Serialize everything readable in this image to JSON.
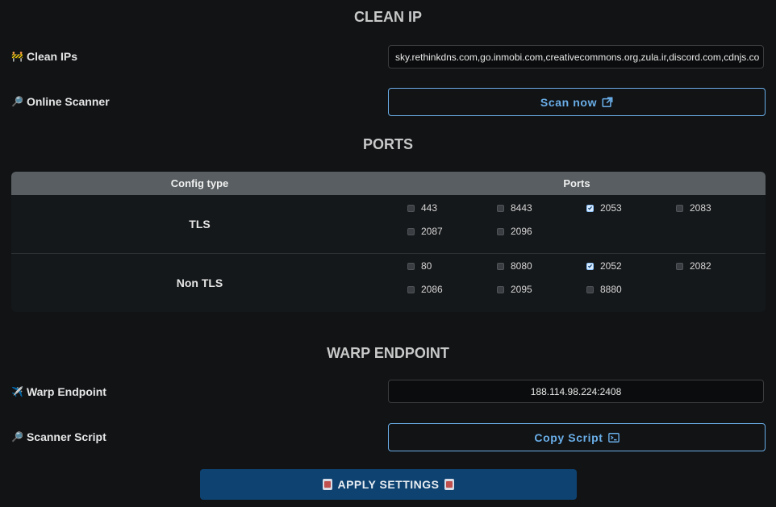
{
  "sections": {
    "clean_ip": "CLEAN IP",
    "ports": "PORTS",
    "warp_endpoint": "WARP ENDPOINT"
  },
  "clean_ip": {
    "label_icon": "🚧",
    "label": "Clean IPs",
    "value": "sky.rethinkdns.com,go.inmobi.com,creativecommons.org,zula.ir,discord.com,cdnjs.co",
    "scanner_icon": "🔎",
    "scanner_label": "Online Scanner",
    "scan_button": "Scan now"
  },
  "ports_table": {
    "header_config": "Config type",
    "header_ports": "Ports",
    "rows": [
      {
        "type": "TLS",
        "ports": [
          {
            "port": "443",
            "checked": false
          },
          {
            "port": "8443",
            "checked": false
          },
          {
            "port": "2053",
            "checked": true
          },
          {
            "port": "2083",
            "checked": false
          },
          {
            "port": "2087",
            "checked": false
          },
          {
            "port": "2096",
            "checked": false
          }
        ]
      },
      {
        "type": "Non TLS",
        "ports": [
          {
            "port": "80",
            "checked": false
          },
          {
            "port": "8080",
            "checked": false
          },
          {
            "port": "2052",
            "checked": true
          },
          {
            "port": "2082",
            "checked": false
          },
          {
            "port": "2086",
            "checked": false
          },
          {
            "port": "2095",
            "checked": false
          },
          {
            "port": "8880",
            "checked": false
          }
        ]
      }
    ]
  },
  "warp": {
    "label_icon": "✈️",
    "label": "Warp Endpoint",
    "value": "188.114.98.224:2408",
    "script_icon": "🔎",
    "script_label": "Scanner Script",
    "copy_button": "Copy Script"
  },
  "apply_button": "APPLY SETTINGS",
  "colors": {
    "background": "#111315",
    "accent": "#6aaee8",
    "apply": "#0e4270",
    "table_header": "#585e61"
  }
}
